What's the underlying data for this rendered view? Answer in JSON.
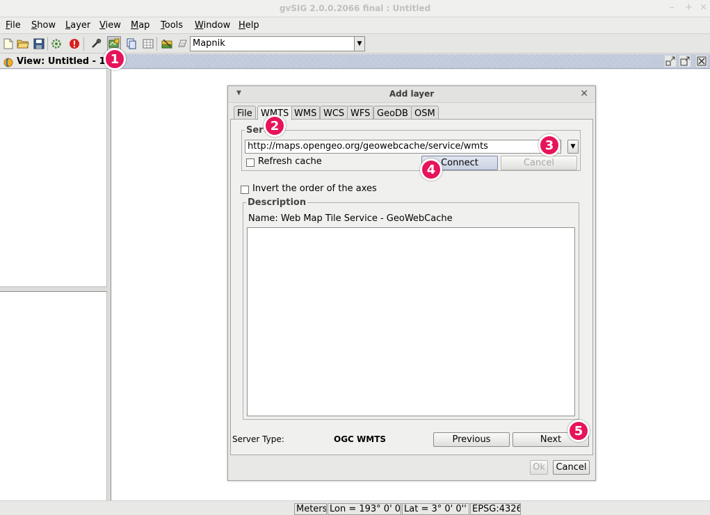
{
  "window": {
    "title": "gvSIG 2.0.0.2066 final : Untitled",
    "min": "–",
    "max": "+",
    "close": "×"
  },
  "menu": {
    "items": [
      {
        "first": "F",
        "rest": "ile"
      },
      {
        "first": "S",
        "rest": "how"
      },
      {
        "first": "L",
        "rest": "ayer"
      },
      {
        "first": "V",
        "rest": "iew"
      },
      {
        "first": "M",
        "rest": "ap"
      },
      {
        "first": "T",
        "rest": "ools"
      },
      {
        "first": "W",
        "rest": "indow"
      },
      {
        "first": "H",
        "rest": "elp"
      }
    ]
  },
  "toolbar": {
    "tile_provider_value": "Mapnik"
  },
  "view": {
    "title": "View: Untitled - 1"
  },
  "statusbar": {
    "units": "Meters",
    "lon": "Lon = 193° 0' 0''",
    "lat": "Lat = 3° 0' 0''",
    "crs": "EPSG:4326"
  },
  "dialog": {
    "title": "Add layer",
    "tabs": [
      "File",
      "WMTS",
      "WMS",
      "WCS",
      "WFS",
      "GeoDB",
      "OSM"
    ],
    "active_tab": "WMTS",
    "server_group": "Server",
    "server_url": "http://maps.opengeo.org/geowebcache/service/wmts",
    "refresh_cache": "Refresh cache",
    "connect": "Connect",
    "cancel_connect": "Cancel",
    "invert_axes": "Invert the order of the axes",
    "description_group": "Description",
    "description_name": "Name: Web Map Tile Service - GeoWebCache",
    "server_type_label": "Server Type:",
    "server_type_value": "OGC WMTS",
    "previous": "Previous",
    "next": "Next",
    "ok": "Ok",
    "cancel": "Cancel"
  },
  "annotations": [
    "1",
    "2",
    "3",
    "4",
    "5"
  ],
  "colors": {
    "badge": "#e6145a",
    "view_header": "#d2d8e6"
  }
}
